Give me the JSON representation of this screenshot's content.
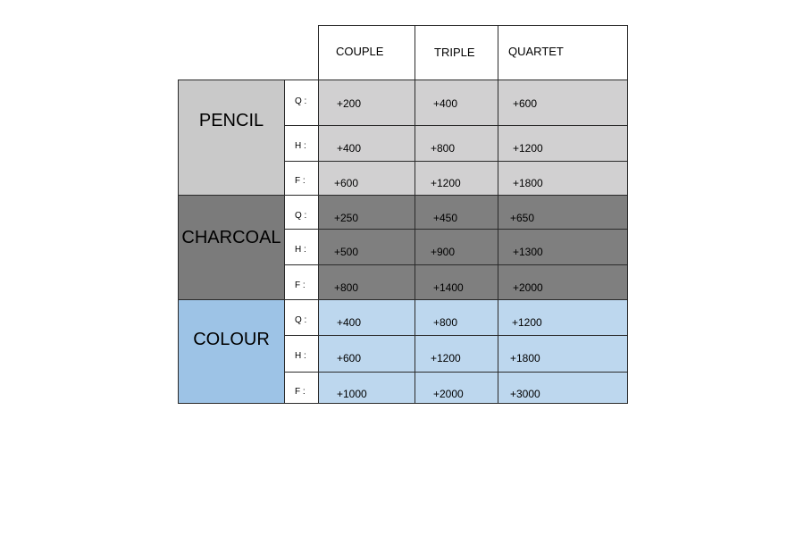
{
  "columns": [
    "COUPLE",
    "TRIPLE",
    "QUARTET"
  ],
  "groups": [
    {
      "name": "PENCIL",
      "colors": {
        "label": "#c9c9c9",
        "cells": "#d1d0d1"
      },
      "rows": [
        {
          "size": "Q  :",
          "values": [
            "+200",
            "+400",
            "+600"
          ]
        },
        {
          "size": "H  :",
          "values": [
            "+400",
            "+800",
            "+1200"
          ]
        },
        {
          "size": "F  :",
          "values": [
            "+600",
            "+1200",
            "+1800"
          ]
        }
      ]
    },
    {
      "name": "CHARCOAL",
      "colors": {
        "label": "#7b7b7b",
        "cells": "#7f7f7f"
      },
      "rows": [
        {
          "size": "Q  :",
          "values": [
            "+250",
            "+450",
            "+650"
          ]
        },
        {
          "size": "H  :",
          "values": [
            "+500",
            "+900",
            "+1300"
          ]
        },
        {
          "size": "F  :",
          "values": [
            "+800",
            "+1400",
            "+2000"
          ]
        }
      ]
    },
    {
      "name": "COLOUR",
      "colors": {
        "label": "#9dc3e6",
        "cells": "#bdd7ee"
      },
      "rows": [
        {
          "size": "Q  :",
          "values": [
            "+400",
            "+800",
            "+1200"
          ]
        },
        {
          "size": "H  :",
          "values": [
            "+600",
            "+1200",
            "+1800"
          ]
        },
        {
          "size": "F  :",
          "values": [
            "+1000",
            "+2000",
            "+3000"
          ]
        }
      ]
    }
  ]
}
